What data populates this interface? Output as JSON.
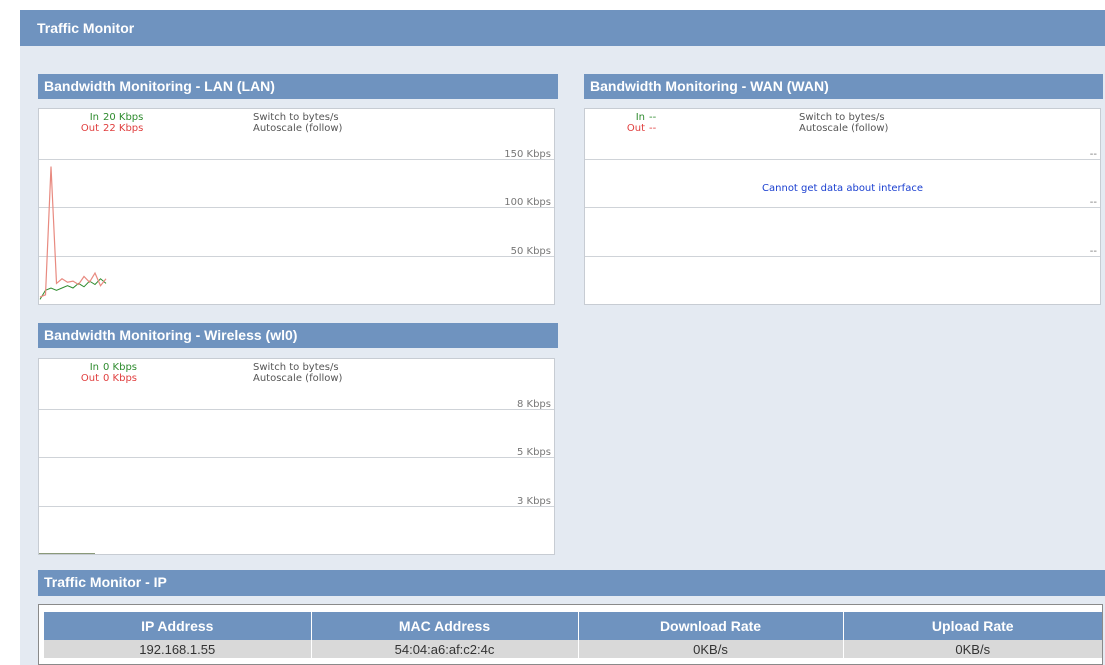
{
  "page_title": "Traffic Monitor",
  "colors": {
    "header": "#6f93bf",
    "in": "#2e8b2e",
    "out": "#e03e3e",
    "link": "#1a3fd0"
  },
  "lan": {
    "title": "Bandwidth Monitoring - LAN (LAN)",
    "in_label": "In",
    "in_value": "20 Kbps",
    "out_label": "Out",
    "out_value": "22 Kbps",
    "switch_label": "Switch to bytes/s",
    "autoscale_label": "Autoscale (follow)",
    "scale_labels": [
      "150 Kbps",
      "100 Kbps",
      "50 Kbps"
    ],
    "series_in_kbps": [
      4,
      12,
      14,
      12,
      14,
      16,
      14,
      18,
      15,
      20,
      17,
      22,
      18
    ],
    "series_out_kbps": [
      6,
      8,
      120,
      18,
      22,
      19,
      20,
      17,
      24,
      19,
      27,
      16,
      22
    ],
    "y_max_kbps": 165
  },
  "wan": {
    "title": "Bandwidth Monitoring - WAN (WAN)",
    "in_label": "In",
    "in_value": "--",
    "out_label": "Out",
    "out_value": "--",
    "switch_label": "Switch to bytes/s",
    "autoscale_label": "Autoscale (follow)",
    "message": "Cannot get data about interface",
    "scale_labels": [
      "--",
      "--",
      "--"
    ]
  },
  "wireless": {
    "title": "Bandwidth Monitoring - Wireless (wl0)",
    "in_label": "In",
    "in_value": "0 Kbps",
    "out_label": "Out",
    "out_value": "0 Kbps",
    "switch_label": "Switch to bytes/s",
    "autoscale_label": "Autoscale (follow)",
    "scale_labels": [
      "8 Kbps",
      "5 Kbps",
      "3 Kbps"
    ]
  },
  "ip_monitor": {
    "title": "Traffic Monitor - IP",
    "columns": [
      "IP Address",
      "MAC Address",
      "Download Rate",
      "Upload Rate"
    ],
    "rows": [
      [
        "192.168.1.55",
        "54:04:a6:af:c2:4c",
        "0KB/s",
        "0KB/s"
      ]
    ]
  }
}
